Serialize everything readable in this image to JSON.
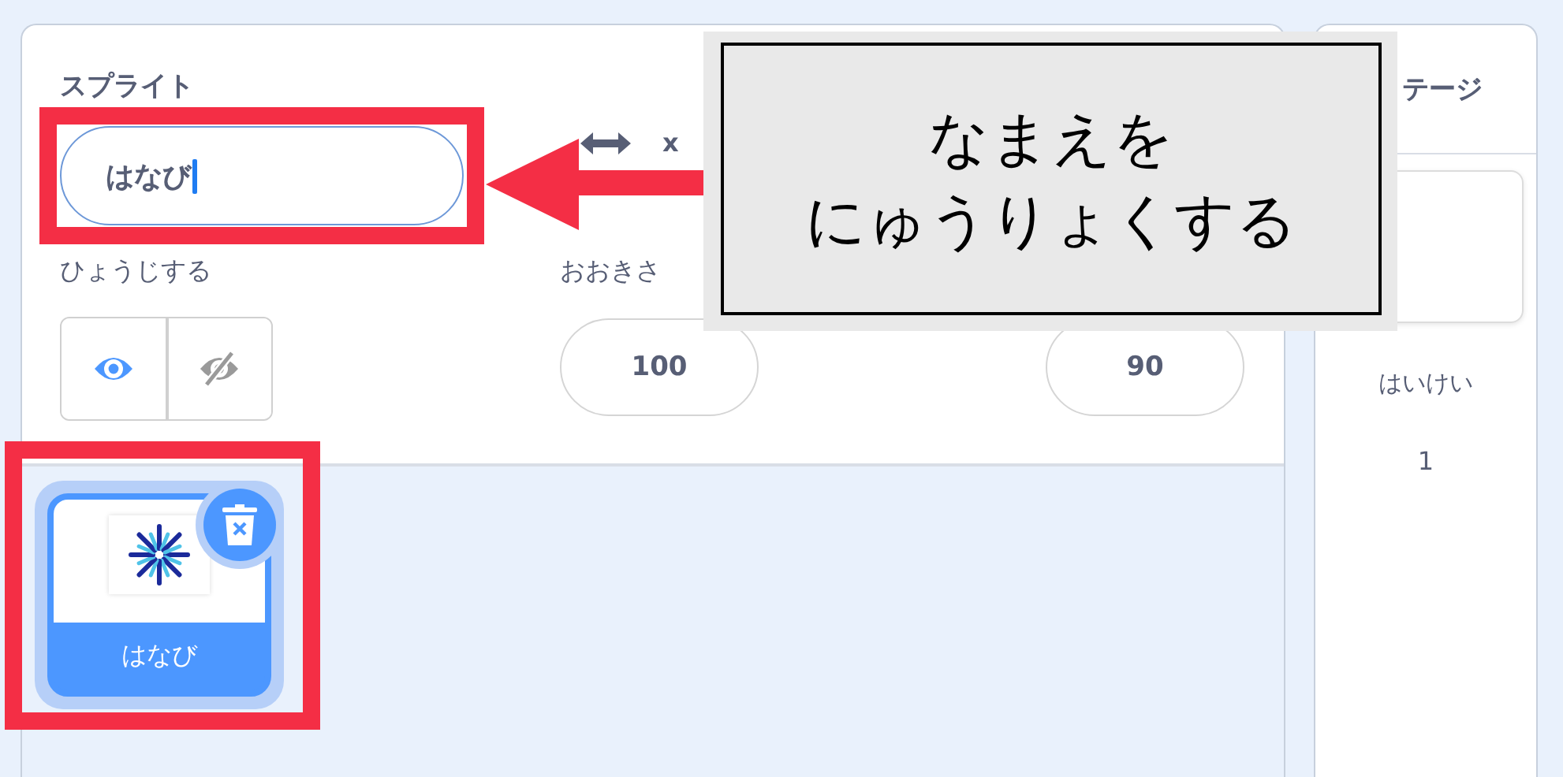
{
  "sprite_panel": {
    "title": "スプライト",
    "name_field": {
      "value": "はなび"
    },
    "x_label": "x",
    "show": {
      "label": "ひょうじする",
      "options": [
        {
          "kind": "show",
          "selected": true
        },
        {
          "kind": "hide",
          "selected": false
        }
      ]
    },
    "size": {
      "label": "おおきさ",
      "value": "100"
    },
    "direction": {
      "value": "90"
    }
  },
  "sprites": [
    {
      "name": "はなび",
      "selected": true
    }
  ],
  "stage_panel": {
    "title": "テージ",
    "backdrops_label": "はいけい",
    "backdrops_count": "1"
  },
  "annotation": {
    "text_lines": [
      "なまえを",
      "にゅうりょくする"
    ]
  }
}
